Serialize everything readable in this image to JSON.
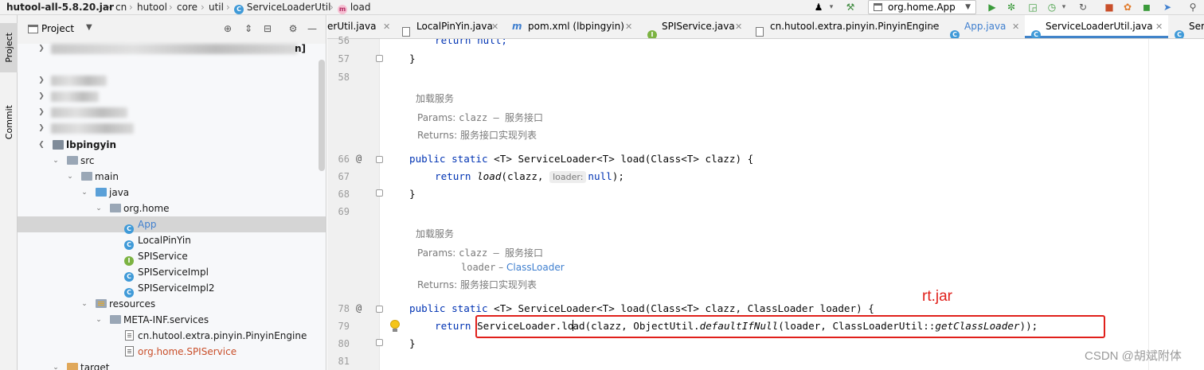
{
  "navbar": {
    "crumbs": [
      "hutool-all-5.8.20.jar",
      "cn",
      "hutool",
      "core",
      "util",
      "ServiceLoaderUtil",
      "load"
    ],
    "run_config": "org.home.App",
    "class_badge": "C",
    "method_badge": "m"
  },
  "left_strip": {
    "project_tab": "Project",
    "commit_tab": "Commit"
  },
  "project_panel": {
    "title": "Project",
    "partial_text": "n]",
    "tree": [
      {
        "label": "lbpingyin"
      },
      {
        "label": "src"
      },
      {
        "label": "main"
      },
      {
        "label": "java"
      },
      {
        "label": "org.home"
      },
      {
        "label": "App"
      },
      {
        "label": "LocalPinYin"
      },
      {
        "label": "SPIService"
      },
      {
        "label": "SPIServiceImpl"
      },
      {
        "label": "SPIServiceImpl2"
      },
      {
        "label": "resources"
      },
      {
        "label": "META-INF.services"
      },
      {
        "label": "cn.hutool.extra.pinyin.PinyinEngine"
      },
      {
        "label": "org.home.SPIService"
      },
      {
        "label": "target"
      }
    ],
    "colors": {
      "app": "#3f7fcf",
      "spi_file": "#c94f2a",
      "selection": "#d5d5d5"
    }
  },
  "editor_tabs": [
    {
      "label": "erUtil.java"
    },
    {
      "label": "LocalPinYin.java"
    },
    {
      "label": "pom.xml (lbpingyin)"
    },
    {
      "label": "SPIService.java"
    },
    {
      "label": "cn.hutool.extra.pinyin.PinyinEngine"
    },
    {
      "label": "App.java"
    },
    {
      "label": "ServiceLoaderUtil.java"
    },
    {
      "label": "Ser"
    }
  ],
  "gutter": {
    "line_numbers": [
      "56",
      "57",
      "58",
      "66",
      "67",
      "68",
      "69",
      "78",
      "79",
      "80",
      "81"
    ],
    "at": "@"
  },
  "code": {
    "line_56": "return null;",
    "line_57": "}",
    "doc1": {
      "title": "加载服务",
      "params_label": "Params:",
      "params_value": "clazz – 服务接口",
      "returns_label": "Returns:",
      "returns_value": "服务接口实现列表"
    },
    "m1_public": "public",
    "m1_static": "static",
    "m1_rest": " <T> ServiceLoader<T> load(Class<T> clazz) {",
    "m1_return": "return",
    "m1_call": " load",
    "m1_args": "(clazz, ",
    "m1_hint": "loader:",
    "m1_null": "null",
    "m1_end": ");",
    "m1_close": "}",
    "doc2": {
      "title": "加载服务",
      "params_label": "Params:",
      "params_value": "clazz – 服务接口",
      "loader_name": "loader",
      "loader_sep": " – ",
      "loader_type": "ClassLoader",
      "returns_label": "Returns:",
      "returns_value": "服务接口实现列表"
    },
    "m2_public": "public",
    "m2_static": "static",
    "m2_rest": " <T> ServiceLoader<T> load(Class<T> clazz, ClassLoader loader) {",
    "m2_return": "return",
    "m2_a": " ServiceLoader.",
    "m2_b": "lo",
    "m2_c": "ad",
    "m2_d": "(clazz, ObjectUtil.",
    "m2_e": "defaultIfNull",
    "m2_f": "(loader, ClassLoaderUtil::",
    "m2_g": "getClassLoader",
    "m2_h": "));",
    "m2_close": "}"
  },
  "annotation": {
    "note": "rt.jar",
    "color": "#e0201b"
  },
  "watermark": "CSDN @胡斌附体"
}
